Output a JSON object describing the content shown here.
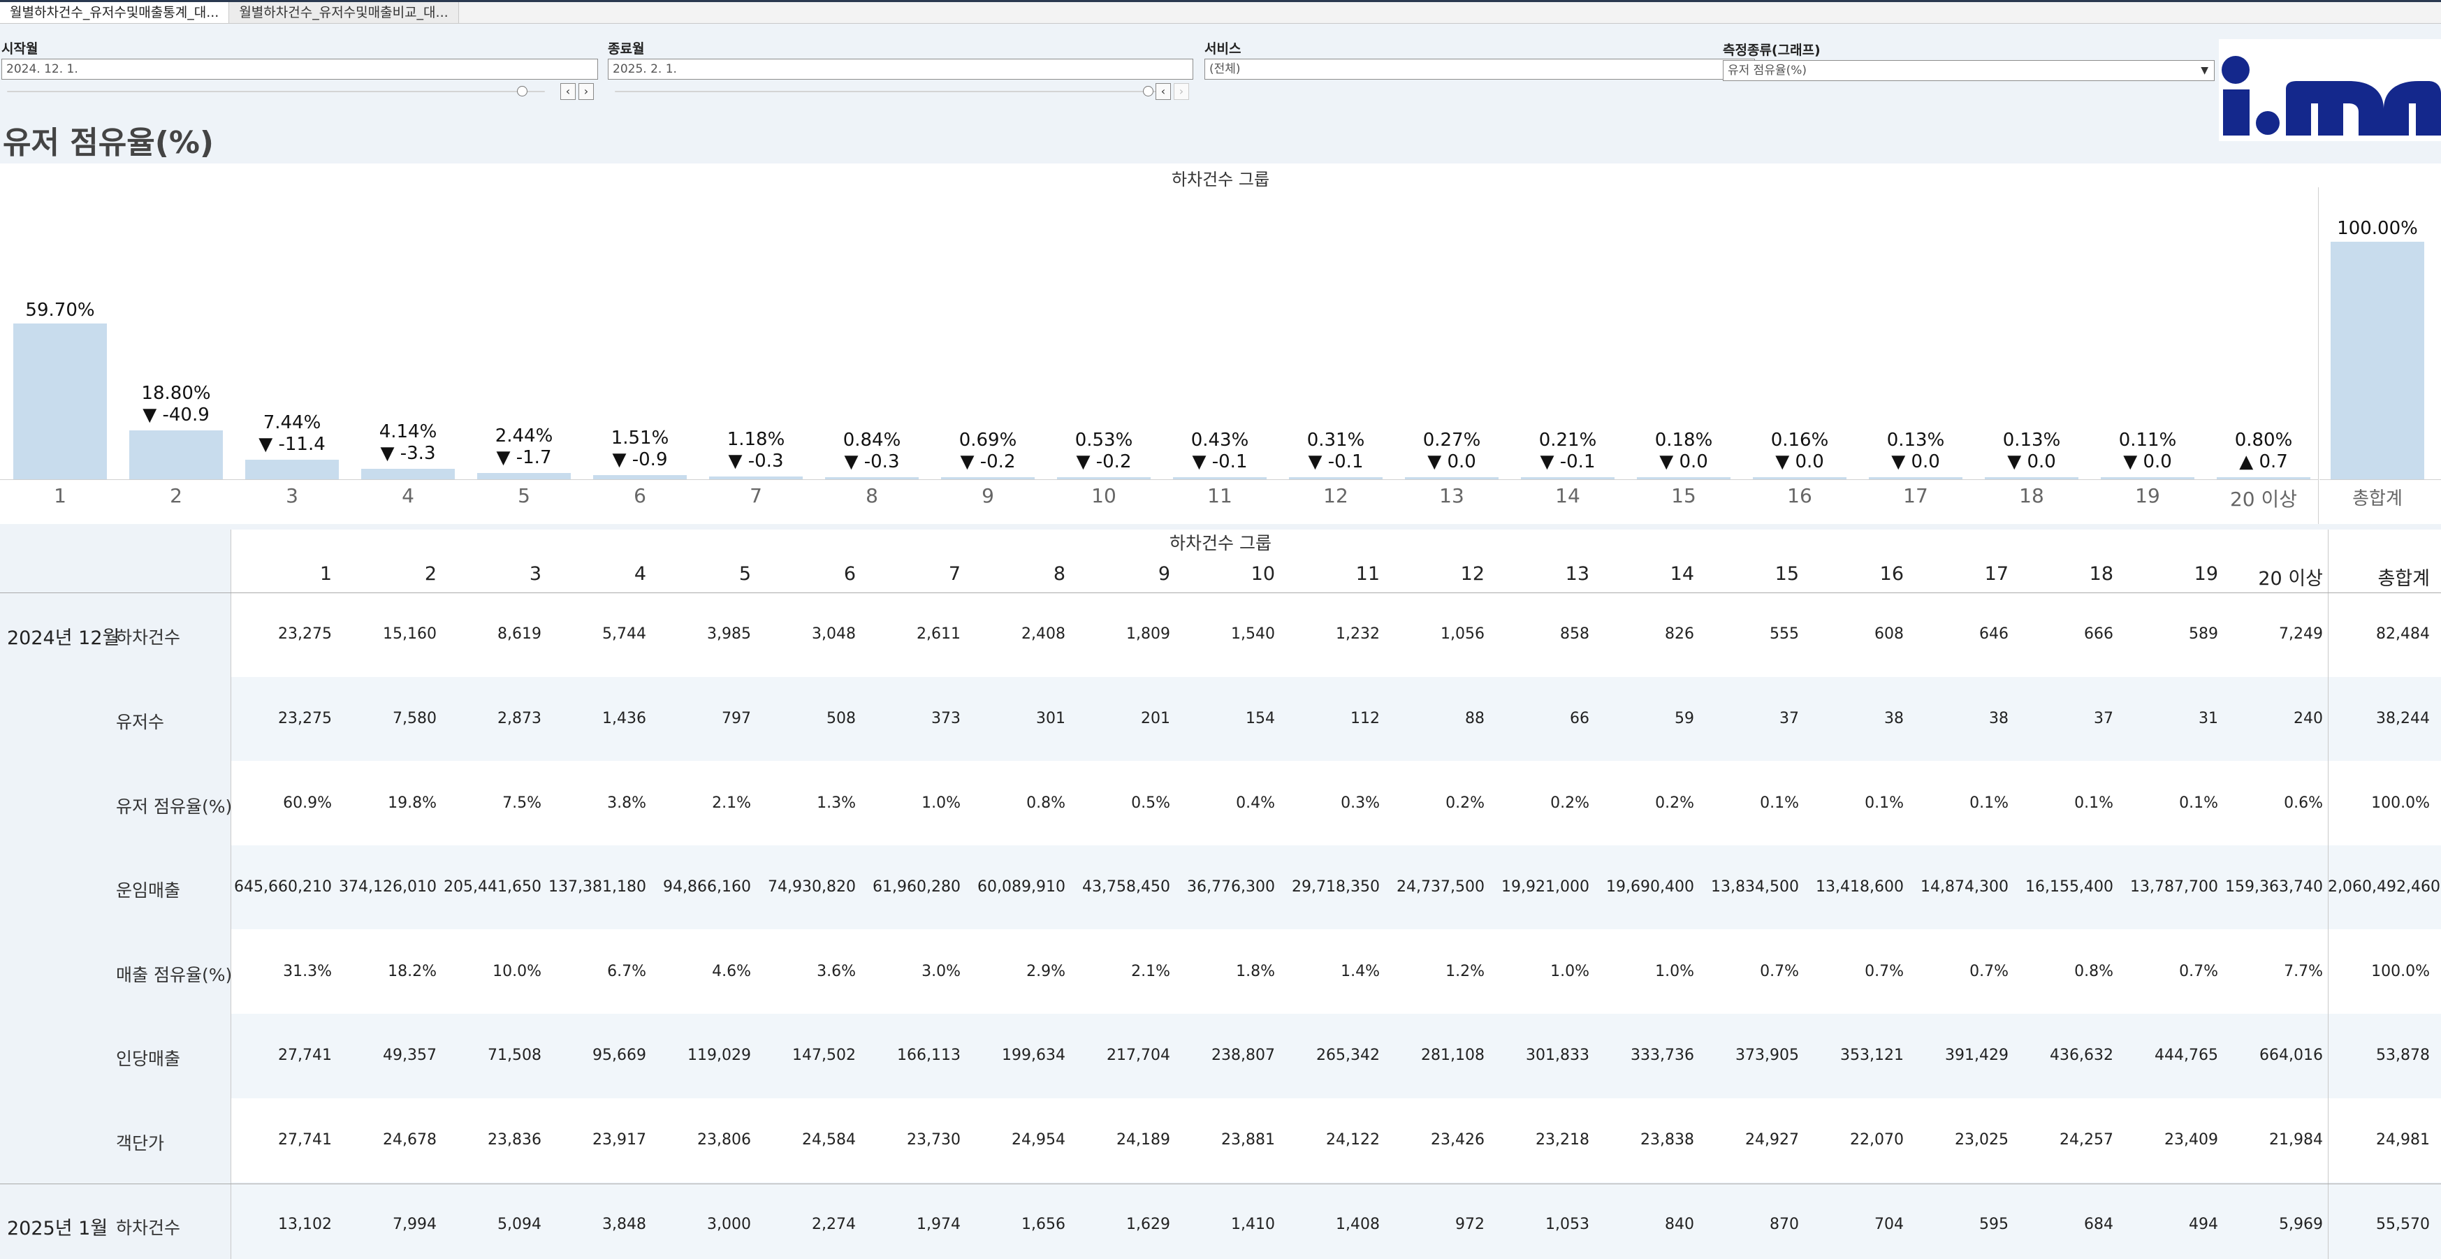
{
  "tabs": [
    {
      "label": "월별하차건수_유저수및매출통계_대..."
    },
    {
      "label": "월별하차건수_유저수및매출비교_대..."
    }
  ],
  "filters": {
    "start": {
      "label": "시작월",
      "value": "2024. 12. 1."
    },
    "end": {
      "label": "종료월",
      "value": "2025. 2. 1."
    },
    "service": {
      "label": "서비스",
      "value": "(전체)"
    },
    "measure": {
      "label": "측정종류(그래프)",
      "value": "유저 점유율(%)"
    }
  },
  "page_title": "유저 점유율(%)",
  "chart_data": {
    "type": "bar",
    "title": "하차건수 그룹",
    "categories": [
      "1",
      "2",
      "3",
      "4",
      "5",
      "6",
      "7",
      "8",
      "9",
      "10",
      "11",
      "12",
      "13",
      "14",
      "15",
      "16",
      "17",
      "18",
      "19",
      "20 이상"
    ],
    "values": [
      59.7,
      18.8,
      7.44,
      4.14,
      2.44,
      1.51,
      1.18,
      0.84,
      0.69,
      0.53,
      0.43,
      0.31,
      0.27,
      0.21,
      0.18,
      0.16,
      0.13,
      0.13,
      0.11,
      0.8
    ],
    "value_labels": [
      "59.70%",
      "18.80%",
      "7.44%",
      "4.14%",
      "2.44%",
      "1.51%",
      "1.18%",
      "0.84%",
      "0.69%",
      "0.53%",
      "0.43%",
      "0.31%",
      "0.27%",
      "0.21%",
      "0.18%",
      "0.16%",
      "0.13%",
      "0.13%",
      "0.11%",
      "0.80%"
    ],
    "change_labels": [
      "",
      "▼ -40.9",
      "▼ -11.4",
      "▼ -3.3",
      "▼ -1.7",
      "▼ -0.9",
      "▼ -0.3",
      "▼ -0.3",
      "▼ -0.2",
      "▼ -0.2",
      "▼ -0.1",
      "▼ -0.1",
      "▼ 0.0",
      "▼ -0.1",
      "▼ 0.0",
      "▼ 0.0",
      "▼ 0.0",
      "▼ 0.0",
      "▼ 0.0",
      "▲ 0.7"
    ],
    "total": {
      "category": "총합계",
      "value": 100.0,
      "label": "100.00%"
    },
    "ylim": [
      0,
      100
    ],
    "bar_color": "#c8dced"
  },
  "table": {
    "group_title": "하차건수 그룹",
    "columns": [
      "1",
      "2",
      "3",
      "4",
      "5",
      "6",
      "7",
      "8",
      "9",
      "10",
      "11",
      "12",
      "13",
      "14",
      "15",
      "16",
      "17",
      "18",
      "19",
      "20 이상",
      "총합계"
    ],
    "rows": [
      {
        "period": "2024년 12월",
        "metric": "하차건수",
        "values": [
          "23,275",
          "15,160",
          "8,619",
          "5,744",
          "3,985",
          "3,048",
          "2,611",
          "2,408",
          "1,809",
          "1,540",
          "1,232",
          "1,056",
          "858",
          "826",
          "555",
          "608",
          "646",
          "666",
          "589",
          "7,249",
          "82,484"
        ]
      },
      {
        "period": "",
        "metric": "유저수",
        "values": [
          "23,275",
          "7,580",
          "2,873",
          "1,436",
          "797",
          "508",
          "373",
          "301",
          "201",
          "154",
          "112",
          "88",
          "66",
          "59",
          "37",
          "38",
          "38",
          "37",
          "31",
          "240",
          "38,244"
        ]
      },
      {
        "period": "",
        "metric": "유저 점유율(%)",
        "values": [
          "60.9%",
          "19.8%",
          "7.5%",
          "3.8%",
          "2.1%",
          "1.3%",
          "1.0%",
          "0.8%",
          "0.5%",
          "0.4%",
          "0.3%",
          "0.2%",
          "0.2%",
          "0.2%",
          "0.1%",
          "0.1%",
          "0.1%",
          "0.1%",
          "0.1%",
          "0.6%",
          "100.0%"
        ]
      },
      {
        "period": "",
        "metric": "운임매출",
        "values": [
          "645,660,210",
          "374,126,010",
          "205,441,650",
          "137,381,180",
          "94,866,160",
          "74,930,820",
          "61,960,280",
          "60,089,910",
          "43,758,450",
          "36,776,300",
          "29,718,350",
          "24,737,500",
          "19,921,000",
          "19,690,400",
          "13,834,500",
          "13,418,600",
          "14,874,300",
          "16,155,400",
          "13,787,700",
          "159,363,740",
          "2,060,492,460"
        ]
      },
      {
        "period": "",
        "metric": "매출 점유율(%)",
        "values": [
          "31.3%",
          "18.2%",
          "10.0%",
          "6.7%",
          "4.6%",
          "3.6%",
          "3.0%",
          "2.9%",
          "2.1%",
          "1.8%",
          "1.4%",
          "1.2%",
          "1.0%",
          "1.0%",
          "0.7%",
          "0.7%",
          "0.7%",
          "0.8%",
          "0.7%",
          "7.7%",
          "100.0%"
        ]
      },
      {
        "period": "",
        "metric": "인당매출",
        "values": [
          "27,741",
          "49,357",
          "71,508",
          "95,669",
          "119,029",
          "147,502",
          "166,113",
          "199,634",
          "217,704",
          "238,807",
          "265,342",
          "281,108",
          "301,833",
          "333,736",
          "373,905",
          "353,121",
          "391,429",
          "436,632",
          "444,765",
          "664,016",
          "53,878"
        ]
      },
      {
        "period": "",
        "metric": "객단가",
        "values": [
          "27,741",
          "24,678",
          "23,836",
          "23,917",
          "23,806",
          "24,584",
          "23,730",
          "24,954",
          "24,189",
          "23,881",
          "24,122",
          "23,426",
          "23,218",
          "23,838",
          "24,927",
          "22,070",
          "23,025",
          "24,257",
          "23,409",
          "21,984",
          "24,981"
        ]
      },
      {
        "period": "2025년 1월",
        "metric": "하차건수",
        "values": [
          "13,102",
          "7,994",
          "5,094",
          "3,848",
          "3,000",
          "2,274",
          "1,974",
          "1,656",
          "1,629",
          "1,410",
          "1,408",
          "972",
          "1,053",
          "840",
          "870",
          "704",
          "595",
          "684",
          "494",
          "5,969",
          "55,570"
        ]
      }
    ]
  }
}
